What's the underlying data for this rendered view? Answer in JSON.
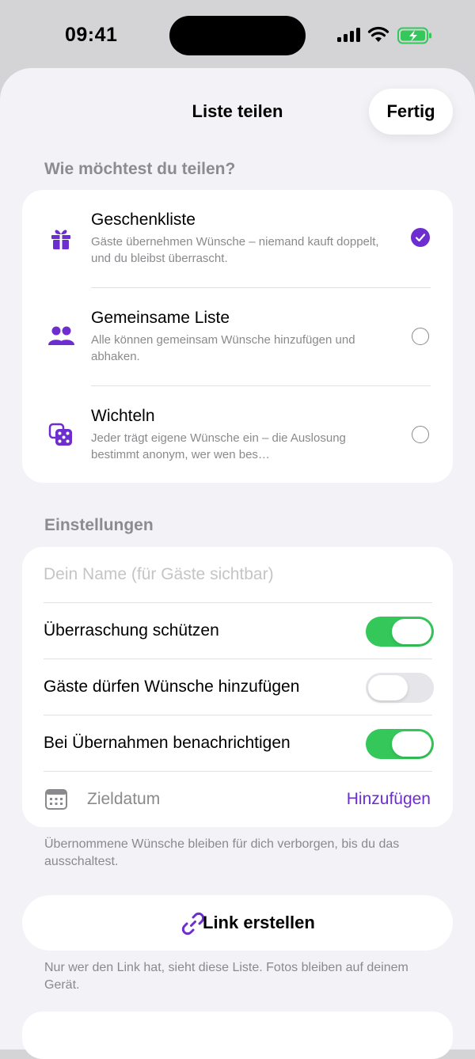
{
  "status_bar": {
    "time": "09:41"
  },
  "sheet": {
    "title": "Liste teilen",
    "done_label": "Fertig"
  },
  "share_mode": {
    "section_label": "Wie möchtest du teilen?",
    "options": [
      {
        "title": "Geschenkliste",
        "description": "Gäste übernehmen Wünsche – niemand kauft doppelt, und du bleibst überrascht.",
        "icon": "gift-icon",
        "selected": true
      },
      {
        "title": "Gemeinsame Liste",
        "description": "Alle können gemeinsam Wünsche hinzufügen und abhaken.",
        "icon": "people-icon",
        "selected": false
      },
      {
        "title": "Wichteln",
        "description": "Jeder trägt eigene Wünsche ein – die Auslosung bestimmt anonym, wer wen bes…",
        "icon": "dice-icon",
        "selected": false
      }
    ]
  },
  "settings": {
    "section_label": "Einstellungen",
    "name_placeholder": "Dein Name (für Gäste sichtbar)",
    "toggles": [
      {
        "label": "Überraschung schützen",
        "on": true
      },
      {
        "label": "Gäste dürfen Wünsche hinzufügen",
        "on": false
      },
      {
        "label": "Bei Übernahmen benachrichtigen",
        "on": true
      }
    ],
    "date_label": "Zieldatum",
    "date_action": "Hinzufügen",
    "footnote": "Übernommene Wünsche bleiben für dich verborgen, bis du das ausschaltest."
  },
  "link": {
    "button_label": "Link erstellen",
    "footnote": "Nur wer den Link hat, sieht diese Liste. Fotos bleiben auf deinem Gerät."
  },
  "colors": {
    "accent": "#6d2ecf",
    "toggle_on": "#34c759",
    "background": "#f2f2f7"
  }
}
